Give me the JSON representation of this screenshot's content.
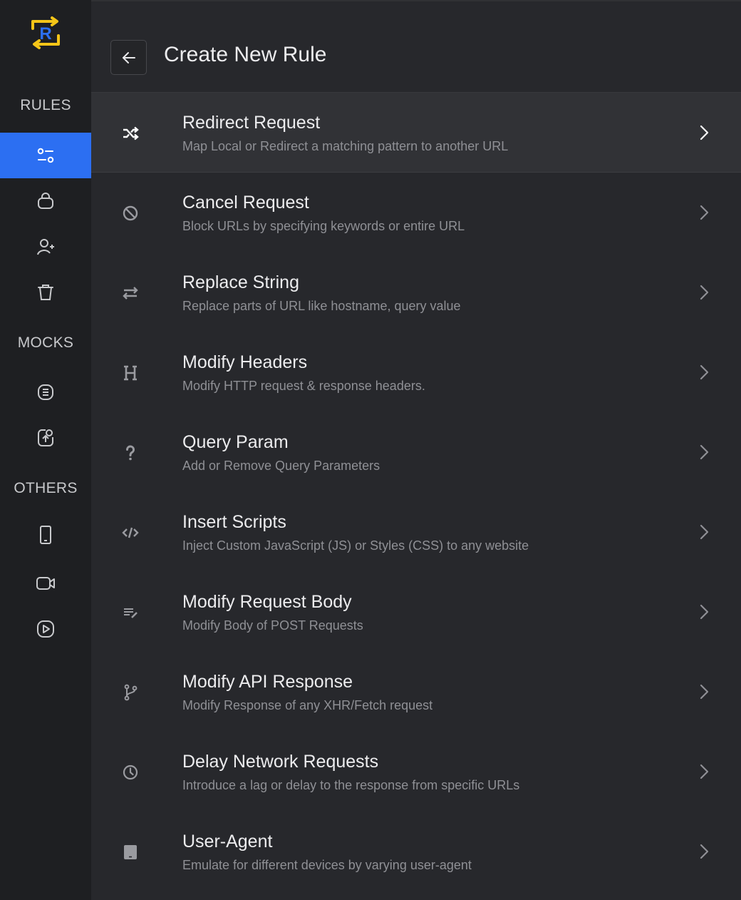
{
  "colors": {
    "accent": "#2c6ff2",
    "logo_yellow": "#f5c518",
    "logo_blue": "#2c6ff2",
    "sidebar_bg": "#1e1f22",
    "main_bg": "#27282c"
  },
  "sidebar": {
    "logo_letter": "R",
    "sections": [
      {
        "label": "RULES",
        "items": [
          {
            "icon": "rules-icon",
            "active": true
          },
          {
            "icon": "shopping-bag-icon",
            "active": false
          },
          {
            "icon": "user-plus-icon",
            "active": false
          },
          {
            "icon": "trash-icon",
            "active": false
          }
        ]
      },
      {
        "label": "MOCKS",
        "items": [
          {
            "icon": "file-list-icon",
            "active": false
          },
          {
            "icon": "upload-file-icon",
            "active": false
          }
        ]
      },
      {
        "label": "OTHERS",
        "items": [
          {
            "icon": "mobile-icon",
            "active": false
          },
          {
            "icon": "video-icon",
            "active": false
          },
          {
            "icon": "play-icon",
            "active": false
          }
        ]
      }
    ]
  },
  "header": {
    "title": "Create New Rule",
    "back_icon": "arrow-left-icon"
  },
  "rules": [
    {
      "title": "Redirect Request",
      "description": "Map Local or Redirect a matching pattern to another URL",
      "icon": "shuffle-icon"
    },
    {
      "title": "Cancel Request",
      "description": "Block URLs by specifying keywords or entire URL",
      "icon": "block-icon"
    },
    {
      "title": "Replace String",
      "description": "Replace parts of URL like hostname, query value",
      "icon": "swap-icon"
    },
    {
      "title": "Modify Headers",
      "description": "Modify HTTP request & response headers.",
      "icon": "header-h-icon"
    },
    {
      "title": "Query Param",
      "description": "Add or Remove Query Parameters",
      "icon": "question-icon"
    },
    {
      "title": "Insert Scripts",
      "description": "Inject Custom JavaScript (JS) or Styles (CSS) to any website",
      "icon": "code-icon"
    },
    {
      "title": "Modify Request Body",
      "description": "Modify Body of POST Requests",
      "icon": "edit-lines-icon"
    },
    {
      "title": "Modify API Response",
      "description": "Modify Response of any XHR/Fetch request",
      "icon": "branch-icon"
    },
    {
      "title": "Delay Network Requests",
      "description": "Introduce a lag or delay to the response from specific URLs",
      "icon": "clock-icon"
    },
    {
      "title": "User-Agent",
      "description": "Emulate for different devices by varying user-agent",
      "icon": "tablet-icon"
    }
  ]
}
